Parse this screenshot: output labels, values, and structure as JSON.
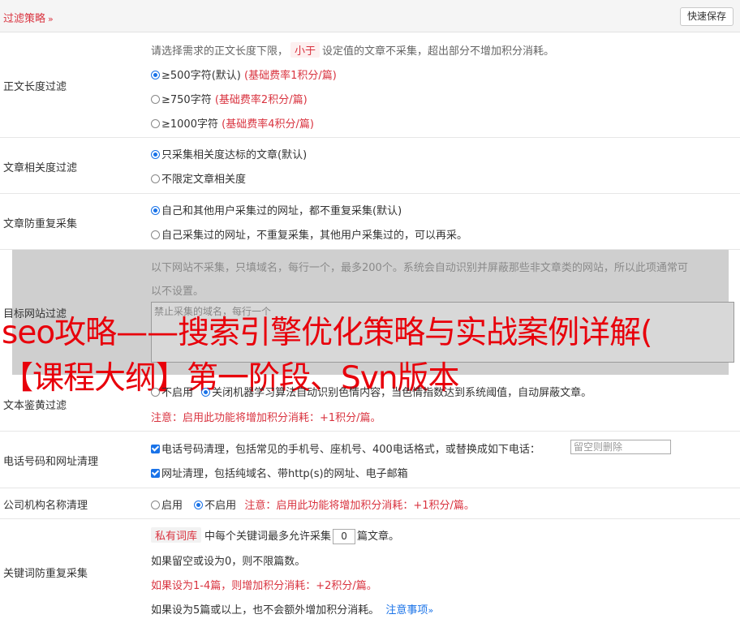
{
  "header": {
    "title": "过滤策略",
    "chevron": "»",
    "save_label": "快速保存"
  },
  "length_filter": {
    "label": "正文长度过滤",
    "desc_before": "请选择需求的正文长度下限，",
    "desc_tag": "小于",
    "desc_after": "设定值的文章不采集，超出部分不增加积分消耗。",
    "options": [
      {
        "text": "≥500字符(默认)",
        "cost": "(基础费率1积分/篇)",
        "selected": true
      },
      {
        "text": "≥750字符",
        "cost": "(基础费率2积分/篇)",
        "selected": false
      },
      {
        "text": "≥1000字符",
        "cost": "(基础费率4积分/篇)",
        "selected": false
      }
    ]
  },
  "relevance_filter": {
    "label": "文章相关度过滤",
    "options": [
      {
        "text": "只采集相关度达标的文章(默认)",
        "selected": true
      },
      {
        "text": "不限定文章相关度",
        "selected": false
      }
    ]
  },
  "duplicate_filter": {
    "label": "文章防重复采集",
    "options": [
      {
        "text": "自己和其他用户采集过的网址，都不重复采集(默认)",
        "selected": true
      },
      {
        "text": "自己采集过的网址，不重复采集，其他用户采集过的，可以再采。",
        "selected": false
      }
    ]
  },
  "target_site": {
    "label": "目标网站过滤",
    "desc_line1": "以下网站不采集，只填域名，每行一个，最多200个。系统会自动识别并屏蔽那些非文章类的网站，所以此项通常可",
    "desc_line2": "以不设置。",
    "placeholder": "禁止采集的域名，每行一个"
  },
  "overlay": {
    "line1": "seo攻略——搜索引擎优化策略与实战案例详解(",
    "line2": "【课程大纲】第一阶段、Svn版本"
  },
  "porn_filter": {
    "label": "文本鉴黄过滤",
    "opt_off": "不启用",
    "opt_on": "关闭",
    "desc": "机器学习算法自动识别色情内容，当色情指数达到系统阈值，自动屏蔽文章。",
    "note": "注意：启用此功能将增加积分消耗：+1积分/篇。"
  },
  "phone_url_clean": {
    "label": "电话号码和网址清理",
    "phone_text": "电话号码清理，包括常见的手机号、座机号、400电话格式，或替换成如下电话：",
    "phone_placeholder": "留空则删除",
    "url_text": "网址清理，包括纯域名、带http(s)的网址、电子邮箱"
  },
  "company_clean": {
    "label": "公司机构名称清理",
    "opt_on": "启用",
    "opt_off": "不启用",
    "note": "注意：启用此功能将增加积分消耗：+1积分/篇。"
  },
  "keyword_dup": {
    "label": "关键词防重复采集",
    "tag": "私有词库",
    "line1_before": "中每个关键词最多允许采集",
    "value": "0",
    "line1_after": "篇文章。",
    "line2": "如果留空或设为0，则不限篇数。",
    "line3": "如果设为1-4篇，则增加积分消耗：+2积分/篇。",
    "line4": "如果设为5篇或以上，也不会额外增加积分消耗。",
    "link": "注意事项",
    "link_chevron": "»"
  }
}
